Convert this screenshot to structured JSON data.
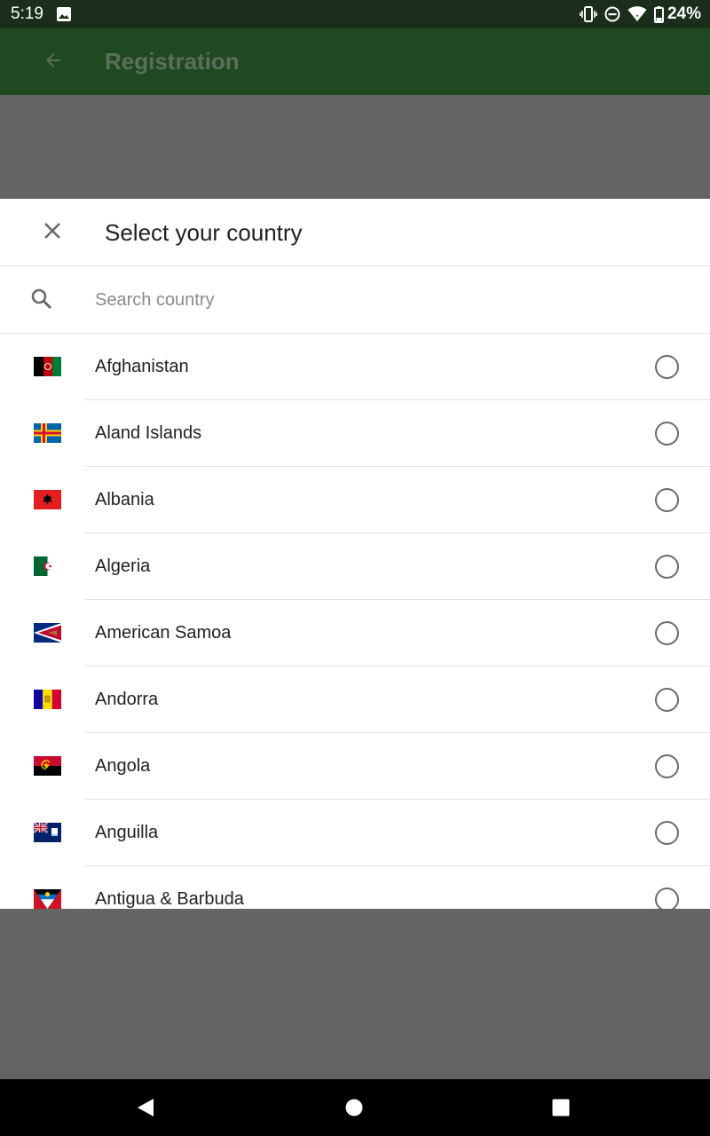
{
  "status_bar": {
    "time": "5:19",
    "battery": "24%",
    "icons": [
      "image-icon",
      "vibrate-icon",
      "do-not-disturb-icon",
      "wifi-icon",
      "battery-icon"
    ]
  },
  "app_bar": {
    "title": "Registration",
    "back_icon": "arrow-back-icon",
    "color": "#1f4a21"
  },
  "dialog": {
    "title": "Select your country",
    "close_icon": "close-icon",
    "search": {
      "placeholder": "Search country",
      "value": "",
      "icon": "search-icon"
    },
    "countries": [
      {
        "name": "Afghanistan",
        "flag": "afghanistan-flag",
        "selected": false
      },
      {
        "name": "Aland Islands",
        "flag": "aland-islands-flag",
        "selected": false
      },
      {
        "name": "Albania",
        "flag": "albania-flag",
        "selected": false
      },
      {
        "name": "Algeria",
        "flag": "algeria-flag",
        "selected": false
      },
      {
        "name": "American Samoa",
        "flag": "american-samoa-flag",
        "selected": false
      },
      {
        "name": "Andorra",
        "flag": "andorra-flag",
        "selected": false
      },
      {
        "name": "Angola",
        "flag": "angola-flag",
        "selected": false
      },
      {
        "name": "Anguilla",
        "flag": "anguilla-flag",
        "selected": false
      },
      {
        "name": "Antigua & Barbuda",
        "flag": "antigua-barbuda-flag",
        "selected": false
      }
    ]
  },
  "nav_bar": {
    "icons": [
      "nav-back-icon",
      "nav-home-icon",
      "nav-recents-icon"
    ]
  }
}
